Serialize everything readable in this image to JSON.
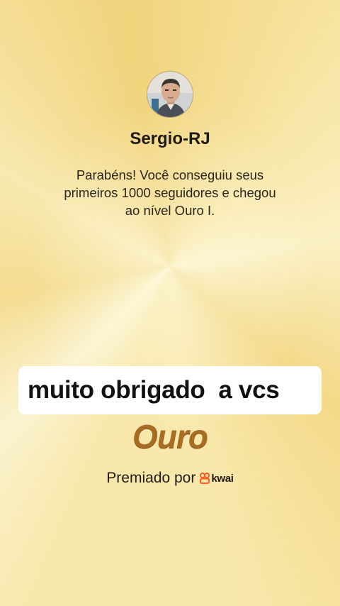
{
  "profile": {
    "avatar_icon": "user-avatar-photo",
    "username": "Sergio-RJ"
  },
  "message": {
    "line1": "Parabéns! Você conseguiu seus",
    "line2": "primeiros 1000 seguidores e chegou",
    "line3": "ao nível Ouro I."
  },
  "caption": {
    "text": "muito obrigado  a vcs"
  },
  "level": {
    "name": "Ouro",
    "color": "#a86d22"
  },
  "sponsor": {
    "label": "Premiado por",
    "brand": "kwai",
    "brand_icon": "kwai-logo-icon",
    "brand_color": "#ff5a1f"
  },
  "colors": {
    "background": "#f6e3a0",
    "caption_bg": "#ffffff"
  }
}
